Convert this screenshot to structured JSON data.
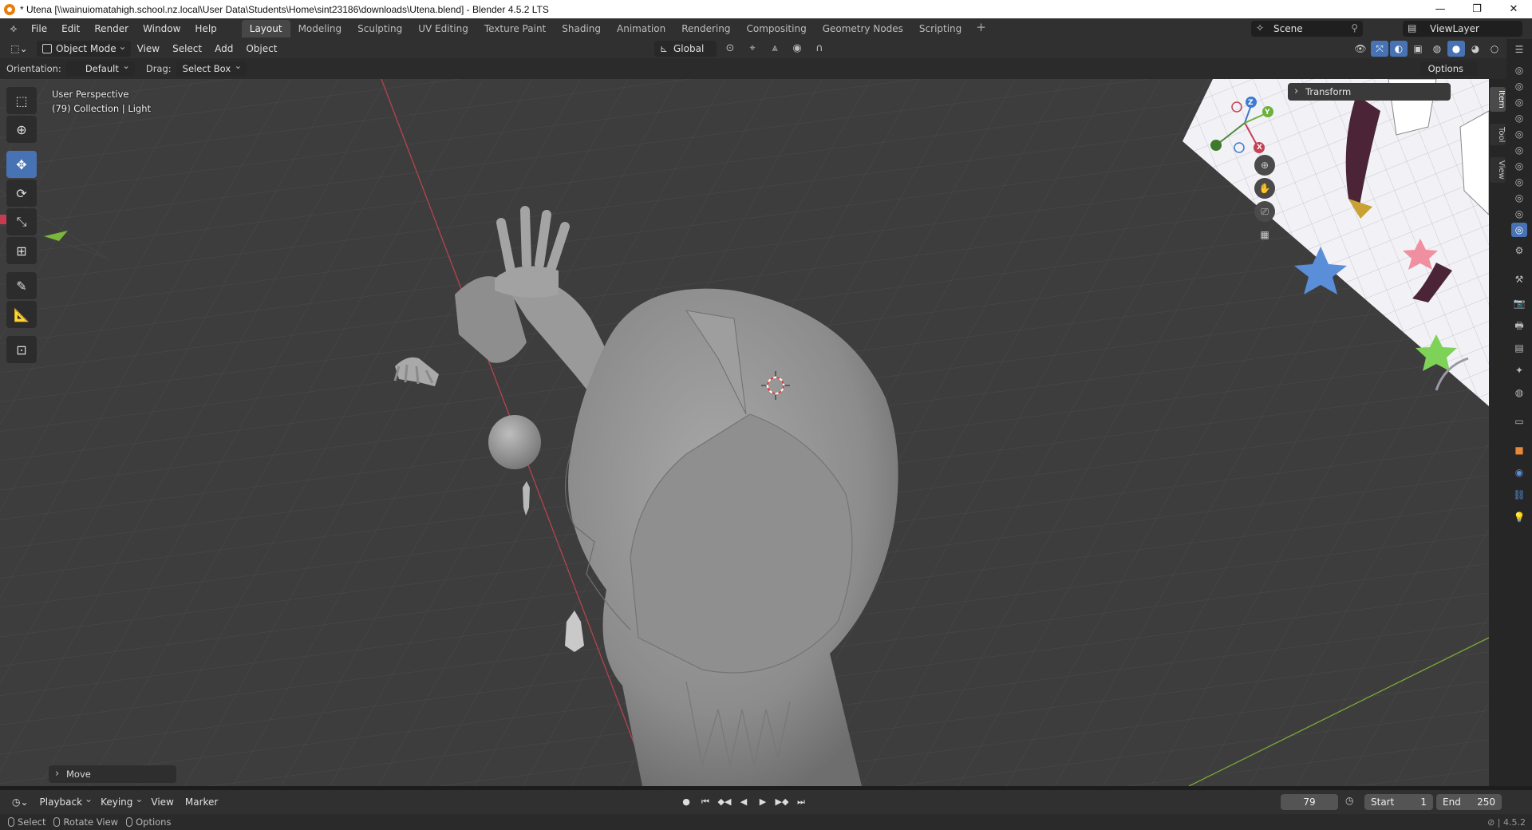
{
  "window": {
    "title": "* Utena [\\\\wainuiomatahigh.school.nz.local\\User Data\\Students\\Home\\sint23186\\downloads\\Utena.blend] - Blender 4.5.2 LTS",
    "minimize": "—",
    "restore": "❐",
    "close": "✕"
  },
  "menu": {
    "items": [
      "File",
      "Edit",
      "Render",
      "Window",
      "Help"
    ]
  },
  "workspaces": {
    "tabs": [
      "Layout",
      "Modeling",
      "Sculpting",
      "UV Editing",
      "Texture Paint",
      "Shading",
      "Animation",
      "Rendering",
      "Compositing",
      "Geometry Nodes",
      "Scripting"
    ],
    "active": "Layout",
    "add": "+"
  },
  "scene": {
    "name": "Scene",
    "view_layer": "ViewLayer"
  },
  "viewport_header": {
    "mode": "Object Mode",
    "menus": [
      "View",
      "Select",
      "Add",
      "Object"
    ],
    "transform_orientation": "Global"
  },
  "tool_settings": {
    "orientation_label": "Orientation:",
    "orientation_value": "Default",
    "drag_label": "Drag:",
    "drag_value": "Select Box",
    "options": "Options"
  },
  "viewport": {
    "perspective": "User Perspective",
    "collection": "(79) Collection | Light",
    "gizmo_axes": [
      "Z",
      "Y",
      "X"
    ]
  },
  "sidebar": {
    "transform_panel": "Transform",
    "tabs": [
      "Item",
      "Tool",
      "View"
    ],
    "active_tab": "Item"
  },
  "last_operator": "Move",
  "timeline": {
    "menus": [
      "Playback",
      "Keying",
      "View",
      "Marker"
    ],
    "current_frame": "79",
    "start_label": "Start",
    "start": "1",
    "end_label": "End",
    "end": "250"
  },
  "statusbar": {
    "hints": [
      "Select",
      "Rotate View",
      "Options"
    ],
    "version": "4.5.2"
  },
  "colors": {
    "accent": "#4772b3",
    "viewport_bg": "#3d3d3d",
    "x_axis": "#d9455b",
    "y_axis": "#8ac43d",
    "z_axis": "#3d8bd9"
  }
}
